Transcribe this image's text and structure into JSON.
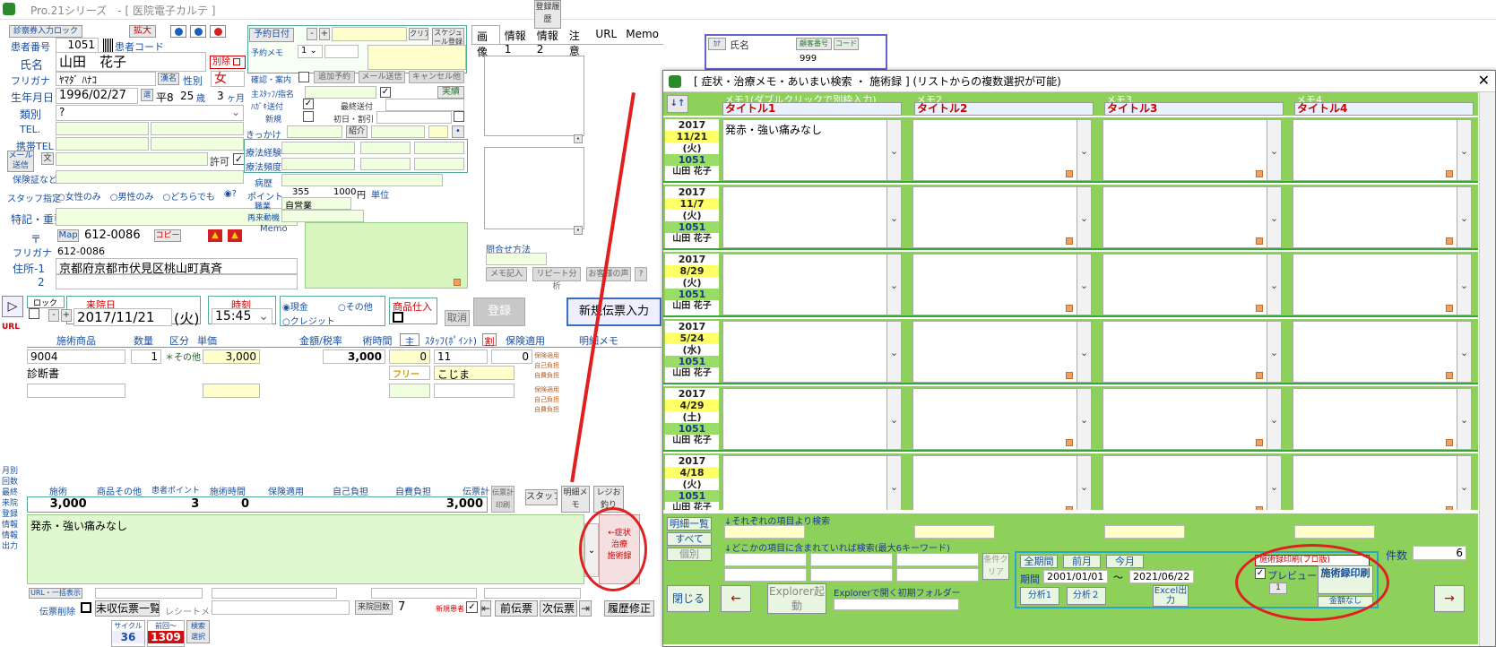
{
  "window": {
    "title": "Pro.21シリーズ　- [ 医院電子カルテ ]"
  },
  "patient": {
    "reader_label": "診察券入力ロック",
    "expand_btn": "拡大",
    "no_label": "患者番号",
    "no_value": "1051",
    "code_label": "患者コード",
    "name_label": "氏名",
    "name_value": "山田　花子",
    "exclude_btn": "別除",
    "kana_label": "フリガナ",
    "kana_value": "ﾔﾏﾀﾞ ﾊﾅｺ",
    "kana_btn": "漢名",
    "sex_label": "性別",
    "sex_value": "女",
    "birth_label": "生年月日",
    "birth_value": "1996/02/27",
    "era": "平8",
    "age": "25",
    "age_unit": "歳",
    "months": "3",
    "months_unit": "ヶ月",
    "category_label": "類別",
    "category_value": "?",
    "tel_label": "TEL.",
    "mobile_label": "携帯TEL",
    "mail_label": "メール送信",
    "permit_label": "許可",
    "insurance_label": "保険証など",
    "staff_label": "スタッフ指定",
    "staff_opt1": "女性のみ",
    "staff_opt2": "男性のみ",
    "staff_opt3": "どちらでも",
    "staff_opt4": "?",
    "special_label": "特記・重要",
    "zip_label": "〒",
    "map_btn": "Map",
    "zip_value": "612-0086",
    "copy_btn": "コピー",
    "addr_kana_label": "フリガナ",
    "addr_kana_value": "612-0086",
    "addr1_label": "住所-1",
    "addr1_value": "京都府京都市伏見区桃山町真斉",
    "addr2_label": "2"
  },
  "booking": {
    "date_btn": "予約日付",
    "memo_label": "予約メモ",
    "memo_num": "1",
    "clear_btn": "クリア",
    "schedule_btn": "スケジュール登録",
    "confirm_label": "確認・案内",
    "add_btn": "追加予約",
    "mail_btn": "メール送信",
    "cancel_btn": "キャンセル他",
    "staff_label": "主ｽﾀｯﾌ/指名",
    "done_btn": "実績",
    "card_label": "ﾊｶﾞｷ送付",
    "last_sent": "最終送付",
    "new_label": "新規",
    "first_label": "初日・割引",
    "trigger_label": "きっかけ",
    "intro_btn": "紹介",
    "exp_label": "療法経験",
    "freq_label": "療法頻度",
    "history_label": "病歴",
    "point_label": "ポイント",
    "point_value": "355",
    "yen_value": "1000",
    "yen_unit": "円",
    "unit_label": "単位",
    "job_label": "職業",
    "job_value": "自営業",
    "motive_label": "再来動機",
    "memo2_label": "Memo"
  },
  "tabs": [
    "画像",
    "情報1",
    "情報2",
    "注意",
    "URL",
    "Memo"
  ],
  "inquiry_label": "問合せ方法",
  "memo_entry_btn": "メモ記入",
  "repeat_btn": "リピート分析",
  "voice_btn": "お客様の声",
  "question_btn": "?",
  "visit": {
    "lock_label": "ロック",
    "date_label": "来院日",
    "date_value": "2017/11/21",
    "dow": "(火)",
    "time_label": "時刻",
    "time_value": "15:45",
    "cash": "現金",
    "other": "その他",
    "credit": "クレジット",
    "goods_btn": "商品仕入",
    "cancel_btn": "取消",
    "register_btn": "登録",
    "reg_history_btn": "登録履歴",
    "new_slip_btn": "新規伝票入力"
  },
  "detail_headers": [
    "施術商品",
    "数量",
    "区分",
    "単価",
    "金額/税率",
    "術時間",
    "主",
    "ｽﾀｯﾌ(ﾎﾟｲﾝﾄ)",
    "割",
    "保険適用",
    "明細メモ"
  ],
  "detail_row1": {
    "code": "9004",
    "qty": "1",
    "kbn": "＊その他",
    "price": "3,000",
    "amount": "3,000",
    "time": "0",
    "staff": "11",
    "point": "0",
    "name": "診断書",
    "free": "フリー",
    "staff2": "こじま"
  },
  "ins_labels": [
    "保険適用",
    "自己負担",
    "自費負担"
  ],
  "side": {
    "url": "URL",
    "monthly": "月別回数",
    "last_visit": "最終来院",
    "reg_info": "登録情報",
    "info_out": "情報出力"
  },
  "totals": {
    "headers": [
      "施術",
      "商品その他",
      "患者ポイント",
      "施術時間",
      "保険適用",
      "自己負担",
      "自費負担",
      "伝票計"
    ],
    "treatment": "3,000",
    "points": "3",
    "time": "0",
    "total": "3,000",
    "slip_print": "伝票計印刷",
    "staff_btn": "スタッフ",
    "detail_memo_btn": "明細メモ",
    "register_btn": "レジお釣り"
  },
  "note_text": "発赤・強い痛みなし",
  "symptom_btn": "←症状\n治療\n施術録",
  "footer": {
    "url_all": "URL・一括表示",
    "slip_delete": "伝票削除",
    "unpaid_list": "未収伝票一覧",
    "receipt_memo": "レシートメモ",
    "visit_count_label": "来院回数",
    "visit_count": "7",
    "new_patient": "新規患者",
    "prev_slip": "前伝票",
    "next_slip": "次伝票",
    "history_fix": "履歴修正",
    "cycle_label": "サイクル",
    "cycle_value": "36",
    "prev_label": "前回～",
    "prev_value": "1309",
    "search_btn": "検索 選択"
  },
  "top_list": {
    "col1": "氏名",
    "btn1": "顧客番号",
    "btn2": "コード",
    "value": "999"
  },
  "modal": {
    "title": "[ 症状・治療メモ・あいまい検索 ・ 施術録 ] (リストからの複数選択が可能)",
    "sort_btn": "↓↑",
    "memo_heads": [
      "メモ1(ダブルクリックで別枠入力)",
      "メモ2",
      "メモ3",
      "メモ4"
    ],
    "memo_titles": [
      "タイトル1",
      "タイトル2",
      "タイトル3",
      "タイトル4"
    ],
    "rows": [
      {
        "year": "2017",
        "md": "11/21",
        "dow": "(火)",
        "no": "1051",
        "name": "山田 花子",
        "memo1": "発赤・強い痛みなし"
      },
      {
        "year": "2017",
        "md": "11/7",
        "dow": "(火)",
        "no": "1051",
        "name": "山田 花子",
        "memo1": ""
      },
      {
        "year": "2017",
        "md": "8/29",
        "dow": "(火)",
        "no": "1051",
        "name": "山田 花子",
        "memo1": ""
      },
      {
        "year": "2017",
        "md": "5/24",
        "dow": "(水)",
        "no": "1051",
        "name": "山田 花子",
        "memo1": ""
      },
      {
        "year": "2017",
        "md": "4/29",
        "dow": "(土)",
        "no": "1051",
        "name": "山田 花子",
        "memo1": ""
      },
      {
        "year": "2017",
        "md": "4/18",
        "dow": "(火)",
        "no": "1051",
        "name": "山田 花子",
        "memo1": ""
      }
    ],
    "detail_list_btn": "明細一覧",
    "all_btn": "すべて",
    "individual_btn": "個別",
    "search_each_label": "↓それぞれの項目より検索",
    "search_any_label": "↓どこかの項目に含まれていれば検索(最大6キーワード)",
    "cond_clear_btn": "条件クリア",
    "all_period_btn": "全期間",
    "prev_month_btn": "前月",
    "this_month_btn": "今月",
    "period_label": "期間",
    "period_from": "2001/01/01",
    "tilde": "～",
    "period_to": "2021/06/22",
    "analysis1_btn": "分析1",
    "analysis2_btn": "分析２",
    "excel_btn": "Excel出力",
    "close_btn": "閉じる",
    "left_arrow": "←",
    "explorer_btn": "Explorer起動",
    "explorer_folder_label": "Explorerで開く初期フォルダー",
    "print_mode": "施術録印刷(プロ版)",
    "preview_label": "プレビュー",
    "print_btn": "施術録印刷",
    "preview_count": "1",
    "no_amount_btn": "金額なし",
    "count_label": "件数",
    "count_value": "6",
    "right_arrow": "→"
  }
}
